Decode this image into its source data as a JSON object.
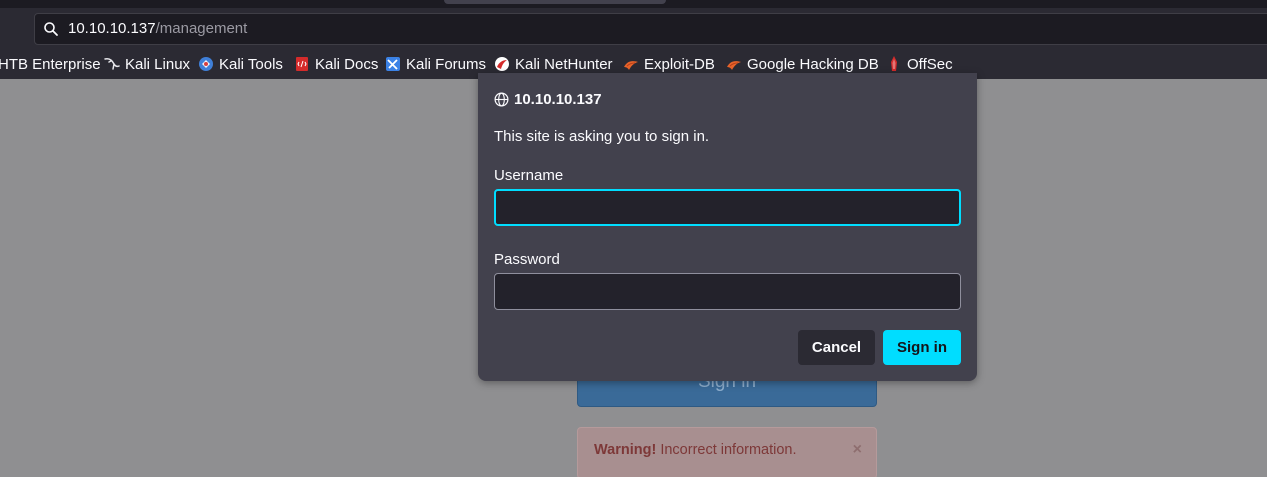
{
  "browser": {
    "url_host": "10.10.10.137",
    "url_path": "/management",
    "bookmarks": [
      {
        "label": "HTB Enterprise",
        "icon": "none"
      },
      {
        "label": "Kali Linux",
        "icon": "kali-dragon-icon"
      },
      {
        "label": "Kali Tools",
        "icon": "kali-tools-icon"
      },
      {
        "label": "Kali Docs",
        "icon": "kali-docs-icon"
      },
      {
        "label": "Kali Forums",
        "icon": "kali-forums-icon"
      },
      {
        "label": "Kali NetHunter",
        "icon": "nethunter-icon"
      },
      {
        "label": "Exploit-DB",
        "icon": "exploit-db-icon"
      },
      {
        "label": "Google Hacking DB",
        "icon": "ghdb-icon"
      },
      {
        "label": "OffSec",
        "icon": "offsec-icon"
      }
    ]
  },
  "dialog": {
    "host": "10.10.10.137",
    "message": "This site is asking you to sign in.",
    "username_label": "Username",
    "username_value": "",
    "password_label": "Password",
    "password_value": "",
    "cancel_label": "Cancel",
    "signin_label": "Sign in"
  },
  "page": {
    "signin_button_label": "Sign in",
    "alert_strong": "Warning!",
    "alert_text": "Incorrect information.",
    "alert_close": "×"
  },
  "colors": {
    "accent": "#00ddff",
    "dialog_bg": "#42414d",
    "toolbar_bg": "#2b2a33"
  }
}
